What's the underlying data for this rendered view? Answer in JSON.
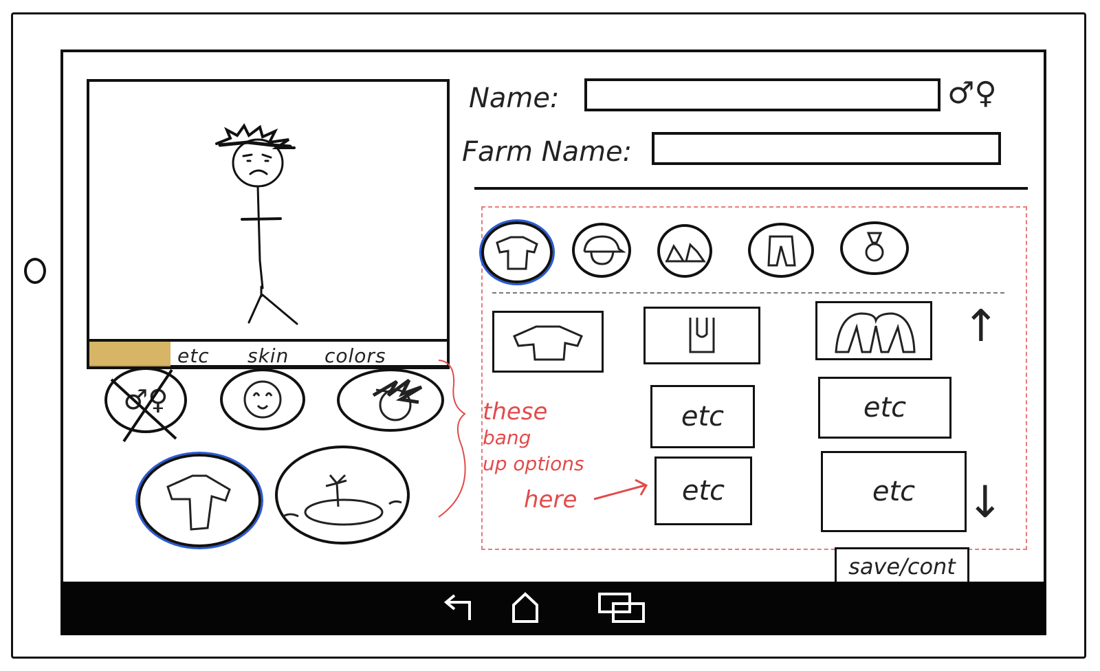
{
  "form": {
    "name_label": "Name:",
    "name_value": "",
    "farm_name_label": "Farm Name:",
    "farm_name_value": "",
    "gender_symbols": "♂♀"
  },
  "preview_tabs": {
    "items": [
      "etc",
      "skin",
      "colors"
    ]
  },
  "left_categories": [
    {
      "icon": "gender-crossed-icon",
      "glyph": "♂♀"
    },
    {
      "icon": "face-icon",
      "glyph": ""
    },
    {
      "icon": "hair-icon",
      "glyph": ""
    },
    {
      "icon": "shirt-icon",
      "glyph": "",
      "selected": true
    },
    {
      "icon": "island-icon",
      "glyph": ""
    }
  ],
  "clothing_tabs": [
    {
      "icon": "shirt-icon",
      "selected": true
    },
    {
      "icon": "hat-icon"
    },
    {
      "icon": "shoes-icon"
    },
    {
      "icon": "pants-icon"
    },
    {
      "icon": "ring-icon"
    }
  ],
  "items_grid": {
    "etc_label": "etc"
  },
  "annotation": {
    "lines": [
      "these",
      "bang",
      "up options",
      "here"
    ]
  },
  "scroll": {
    "up": "↑",
    "down": "↓"
  },
  "save_label": "save/cont",
  "colors": {
    "ink": "#111111",
    "annotation_red": "#e14b4b",
    "selection_blue": "#2a5bd6",
    "active_tab_gold": "#d2ad55"
  }
}
